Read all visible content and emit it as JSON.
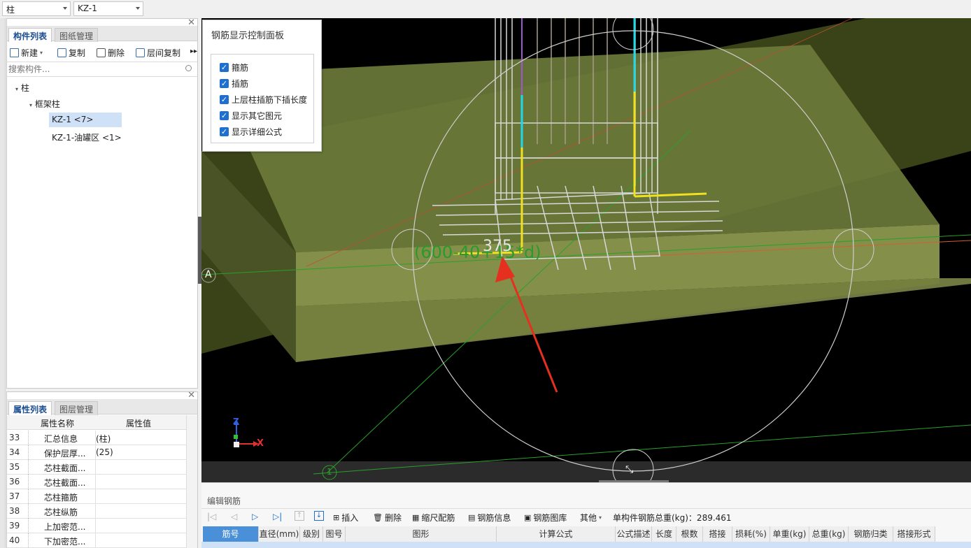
{
  "top": {
    "combo1": "柱",
    "combo2": "KZ-1"
  },
  "comp_panel": {
    "tabs": [
      "构件列表",
      "图纸管理"
    ],
    "toolbar": [
      "新建",
      "复制",
      "删除",
      "层间复制"
    ],
    "search_placeholder": "搜索构件...",
    "tree": {
      "root": "柱",
      "group": "框架柱",
      "items": [
        "KZ-1 <7>",
        "KZ-1-油罐区 <1>"
      ]
    }
  },
  "prop_panel": {
    "tabs": [
      "属性列表",
      "图层管理"
    ],
    "headers": [
      "属性名称",
      "属性值"
    ],
    "rows": [
      {
        "no": "33",
        "name": "汇总信息",
        "value": "(柱)"
      },
      {
        "no": "34",
        "name": "保护层厚...",
        "value": "(25)"
      },
      {
        "no": "35",
        "name": "芯柱截面...",
        "value": ""
      },
      {
        "no": "36",
        "name": "芯柱截面...",
        "value": ""
      },
      {
        "no": "37",
        "name": "芯柱箍筋",
        "value": ""
      },
      {
        "no": "38",
        "name": "芯柱纵筋",
        "value": ""
      },
      {
        "no": "39",
        "name": "上加密范...",
        "value": ""
      },
      {
        "no": "40",
        "name": "下加密范...",
        "value": ""
      }
    ]
  },
  "control_panel": {
    "title": "钢筋显示控制面板",
    "options": [
      "箍筋",
      "插筋",
      "上层柱插筋下插长度",
      "显示其它图元",
      "显示详细公式"
    ]
  },
  "viewport": {
    "formula": "(600-40+15*d)",
    "dim_value": "375",
    "axis_a": "A",
    "axis_1": "1",
    "gizmo": {
      "z": "Z",
      "x": "X"
    }
  },
  "edit_rebar": {
    "title": "编辑钢筋",
    "toolbar": [
      "插入",
      "删除",
      "缩尺配筋",
      "钢筋信息",
      "钢筋图库",
      "其他"
    ],
    "total_label": "单构件钢筋总重(kg)：289.461",
    "columns": [
      "筋号",
      "直径(mm)",
      "级别",
      "图号",
      "图形",
      "计算公式",
      "公式描述",
      "长度",
      "根数",
      "搭接",
      "损耗(%)",
      "单重(kg)",
      "总重(kg)",
      "钢筋归类",
      "搭接形式"
    ]
  },
  "colors": {
    "accent": "#1e6fd0",
    "slab": "#6b7a3a",
    "formula": "#2a9a2a",
    "arrow": "#e53020"
  }
}
